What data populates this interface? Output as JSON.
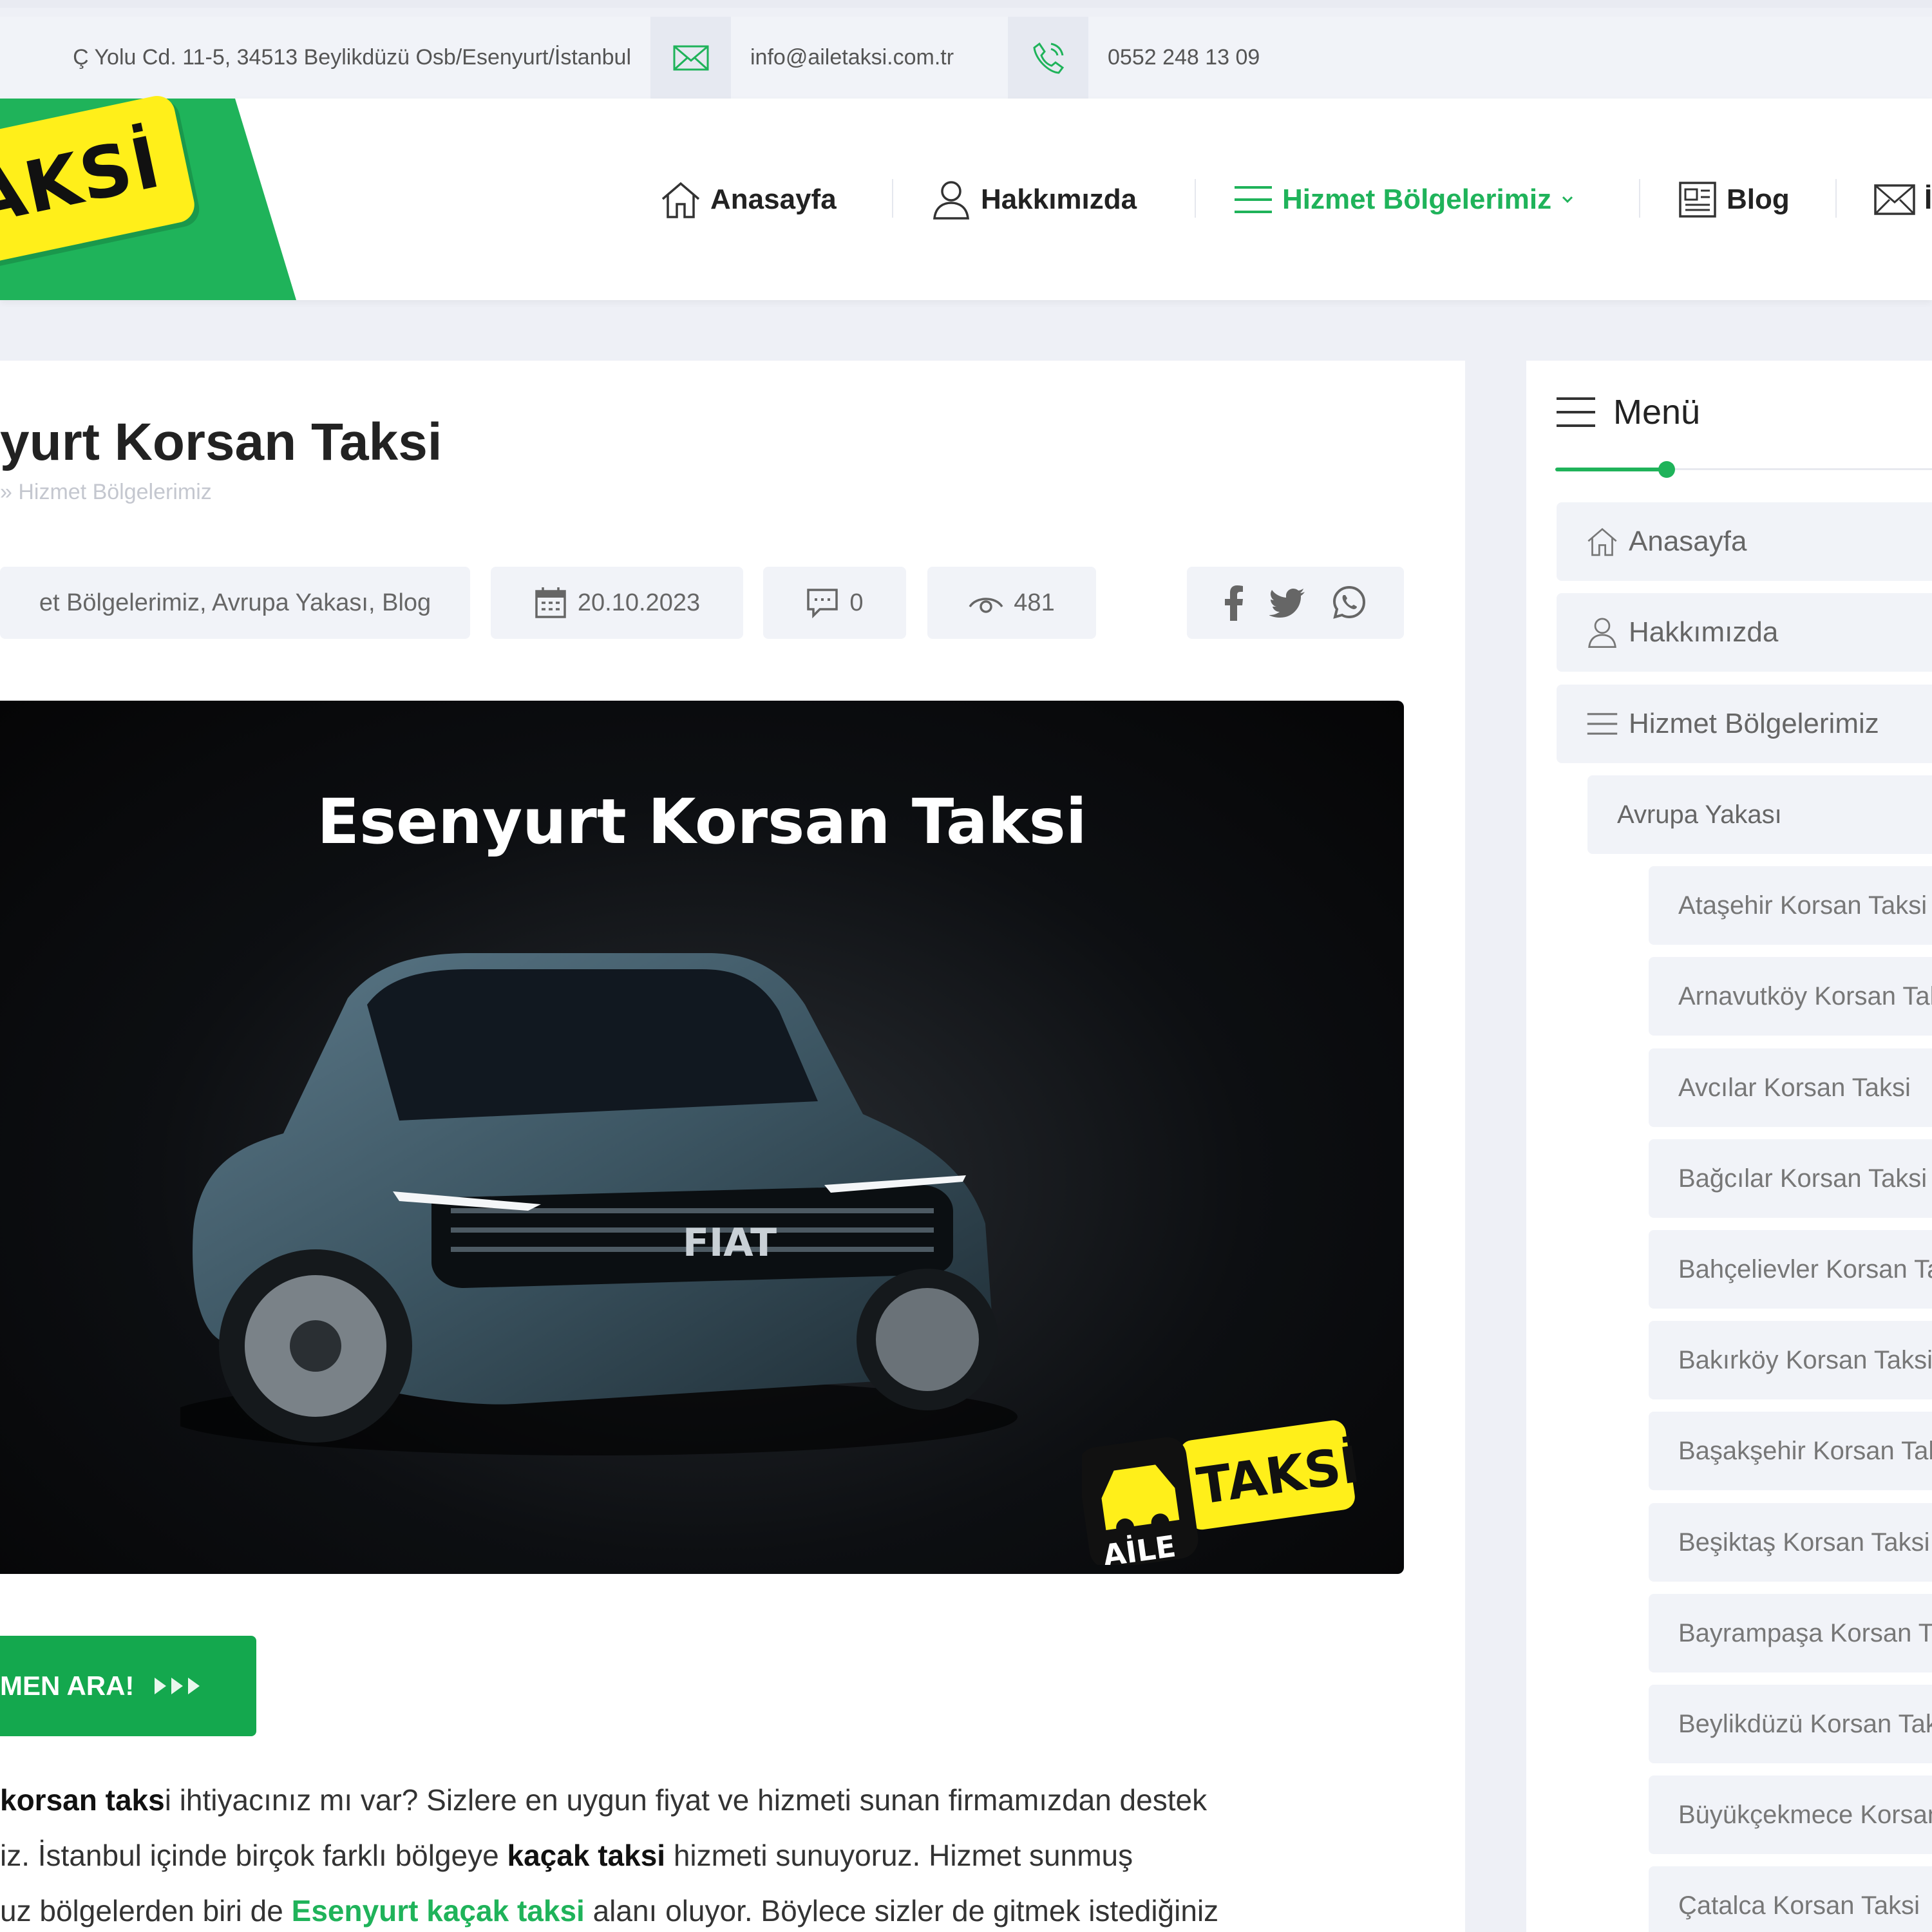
{
  "topbar": {
    "address": "Ç Yolu Cd. 11-5, 34513 Beylikdüzü Osb/Esenyurt/İstanbul",
    "email": "info@ailetaksi.com.tr",
    "phone": "0552 248 13 09"
  },
  "logo": {
    "text": "TAKSİ"
  },
  "nav": {
    "items": [
      {
        "label": "Anasayfa",
        "icon": "home-icon"
      },
      {
        "label": "Hakkımızda",
        "icon": "user-icon"
      },
      {
        "label": "Hizmet Bölgelerimiz",
        "icon": "menu-icon",
        "active": true
      },
      {
        "label": "Blog",
        "icon": "newspaper-icon"
      },
      {
        "label": "İ",
        "icon": "mail-icon"
      }
    ]
  },
  "article": {
    "title": "yurt Korsan Taksi",
    "breadcrumb": "» Hizmet Bölgelerimiz",
    "categories": "et Bölgelerimiz, Avrupa Yakası, Blog",
    "date": "20.10.2023",
    "comments": "0",
    "views": "481",
    "hero_title": "Esenyurt Korsan Taksi",
    "hero_logo_top": "AİLE",
    "hero_logo_main": "TAKSİ",
    "cta": "MEN ARA!",
    "p1": {
      "a": "korsan taks",
      "b": "i ihtiyacınız mı var? Sizlere en uygun fiyat ve hizmeti sunan firmamızdan destek"
    },
    "p2": {
      "a": "iz. İstanbul içinde birçok farklı bölgeye ",
      "b": "kaçak taksi",
      "c": " hizmeti sunuyoruz. Hizmet sunmuş"
    },
    "p3": {
      "a": "uz bölgelerden biri de ",
      "b": "Esenyurt kaçak taksi",
      "c": " alanı oluyor. Böylece sizler de gitmek istediğiniz"
    }
  },
  "sidebar": {
    "title": "Menü",
    "items": [
      {
        "label": "Anasayfa",
        "level": 0,
        "icon": "home-icon"
      },
      {
        "label": "Hakkımızda",
        "level": 0,
        "icon": "user-icon"
      },
      {
        "label": "Hizmet Bölgelerimiz",
        "level": 0,
        "icon": "menu-icon"
      },
      {
        "label": "Avrupa Yakası",
        "level": 1
      },
      {
        "label": "Ataşehir Korsan Taksi",
        "level": 2
      },
      {
        "label": "Arnavutköy Korsan Taksi",
        "level": 2
      },
      {
        "label": "Avcılar Korsan Taksi",
        "level": 2
      },
      {
        "label": "Bağcılar Korsan Taksi",
        "level": 2
      },
      {
        "label": "Bahçelievler Korsan Taksi",
        "level": 2
      },
      {
        "label": "Bakırköy Korsan Taksi",
        "level": 2
      },
      {
        "label": "Başakşehir Korsan Taksi",
        "level": 2
      },
      {
        "label": "Beşiktaş Korsan Taksi",
        "level": 2
      },
      {
        "label": "Bayrampaşa Korsan Taksi",
        "level": 2
      },
      {
        "label": "Beylikdüzü Korsan Taksi",
        "level": 2
      },
      {
        "label": "Büyükçekmece Korsan Taksi",
        "level": 2
      },
      {
        "label": "Çatalca Korsan Taksi",
        "level": 2
      }
    ]
  },
  "colors": {
    "brand_green": "#1fb35a",
    "brand_yellow": "#ffef1a"
  }
}
